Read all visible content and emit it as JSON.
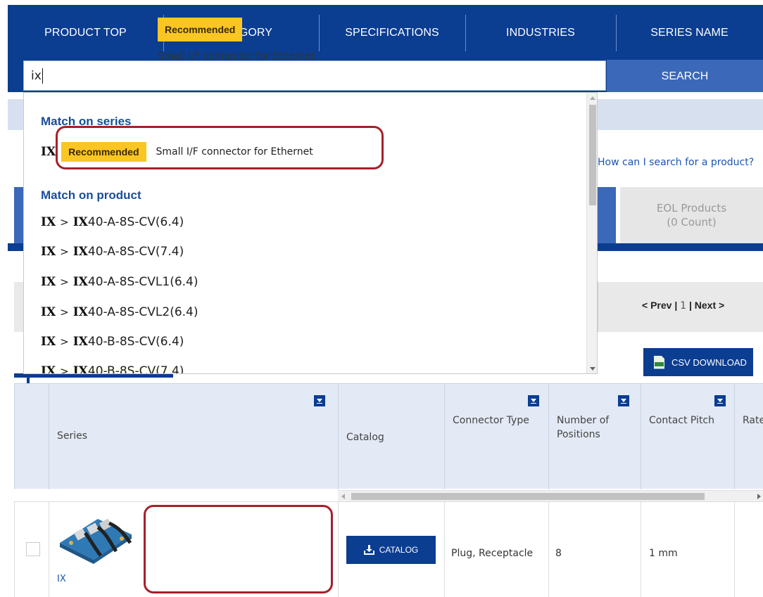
{
  "nav": {
    "tabs": [
      "PRODUCT TOP",
      "CATEGORY",
      "SPECIFICATIONS",
      "INDUSTRIES",
      "SERIES NAME"
    ]
  },
  "search": {
    "value": "ix",
    "button_label": "SEARCH"
  },
  "autocomplete": {
    "series_heading": "Match on series",
    "series": {
      "name": "IX",
      "badge": "Recommended",
      "description": "Small I/F connector for Ethernet"
    },
    "product_heading": "Match on product",
    "separator": ">",
    "products": [
      {
        "series": "IX",
        "match": "IX",
        "suffix": "40-A-8S-CV(6.4)"
      },
      {
        "series": "IX",
        "match": "IX",
        "suffix": "40-A-8S-CV(7.4)"
      },
      {
        "series": "IX",
        "match": "IX",
        "suffix": "40-A-8S-CVL1(6.4)"
      },
      {
        "series": "IX",
        "match": "IX",
        "suffix": "40-A-8S-CVL2(6.4)"
      },
      {
        "series": "IX",
        "match": "IX",
        "suffix": "40-B-8S-CV(6.4)"
      },
      {
        "series": "IX",
        "match": "IX",
        "suffix": "40-B-8S-CV(7.4)"
      }
    ]
  },
  "help_link": "How can I search for a product?",
  "eol_tab": {
    "label": "EOL Products",
    "count": "(0 Count)"
  },
  "pager": {
    "prev": "< Prev",
    "sep1": "|",
    "current": "1",
    "sep2": "|",
    "next": "Next >"
  },
  "csv_button": "CSV DOWNLOAD",
  "table": {
    "headers": {
      "series": "Series",
      "catalog": "Catalog",
      "connector_type": "Connector Type",
      "positions": "Number of Positions",
      "contact_pitch": "Contact Pitch",
      "rated": "Rate"
    },
    "rows": [
      {
        "series_link": "IX",
        "badge": "Recommended",
        "description": "Small I/F connector for Ethernet",
        "catalog_button": "CATALOG",
        "connector_type": "Plug, Receptacle",
        "positions": "8",
        "contact_pitch": "1 mm"
      }
    ]
  },
  "colors": {
    "nav_blue": "#0b3d91",
    "accent_blue": "#3b68b8",
    "badge_yellow": "#f9c623",
    "highlight_red": "#a5202a",
    "link_blue": "#1a56b0"
  }
}
